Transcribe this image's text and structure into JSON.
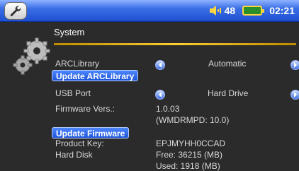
{
  "status": {
    "volume": "48",
    "time": "02:21"
  },
  "icons": {
    "settings": "wrench-icon",
    "section": "gear-icon",
    "volume": "speaker-icon",
    "battery": "battery-icon",
    "left": "left-arrow-icon",
    "right": "right-arrow-icon"
  },
  "colors": {
    "statusbar": "#1f4fcf",
    "accent_rule": "#ffcc33",
    "button": "#1f55d8"
  },
  "section": {
    "title": "System"
  },
  "settings": {
    "arclibrary": {
      "label": "ARCLibrary",
      "value": "Automatic"
    },
    "update_arclibrary": "Update ARCLibrary",
    "usb_port": {
      "label": "USB Port",
      "value": "Hard Drive"
    },
    "firmware": {
      "label": "Firmware Vers.:",
      "value1": "1.0.03",
      "value2": "(WMDRMPD: 10.0)"
    },
    "update_firmware": "Update Firmware",
    "product_key": {
      "label": "Product Key:",
      "value": "EPJMYHH0CCAD"
    },
    "hard_disk": {
      "label": "Hard Disk",
      "free": "Free: 36215 (MB)",
      "used": "Used: 1918 (MB)"
    }
  }
}
